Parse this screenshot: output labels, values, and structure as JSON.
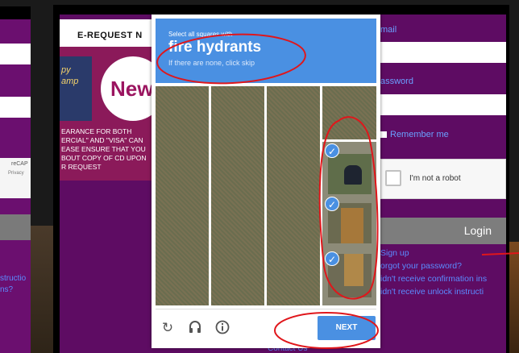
{
  "left_window": {
    "recaptcha_label": "reCAP",
    "privacy_label": "Privacy",
    "links": [
      "structio",
      "ns?"
    ]
  },
  "banner": {
    "title": "E-REQUEST N",
    "badge": "New",
    "stamp": "py amp",
    "text_lines": [
      "EARANCE FOR BOTH",
      "ERCIAL\" AND \"VISA\" CAN",
      "EASE ENSURE THAT YOU",
      "BOUT COPY OF CD UPON",
      "R REQUEST"
    ]
  },
  "form": {
    "email_label": "mail",
    "password_label": "assword",
    "remember_label": "Remember me",
    "robot_label": "I'm not a robot",
    "login_label": "Login",
    "links": [
      "Sign up",
      "orgot your password?",
      "idn't receive confirmation ins",
      "idn't receive unlock instructi"
    ],
    "contact": "Contact Us"
  },
  "captcha": {
    "instruction_small": "Select all squares with",
    "target": "fire hydrants",
    "hint": "If there are none, click skip",
    "next_label": "NEXT",
    "icons": [
      "reload-icon",
      "audio-icon",
      "info-icon"
    ],
    "colors": {
      "accent": "#4a90e2",
      "annotation": "#e0161b"
    }
  }
}
